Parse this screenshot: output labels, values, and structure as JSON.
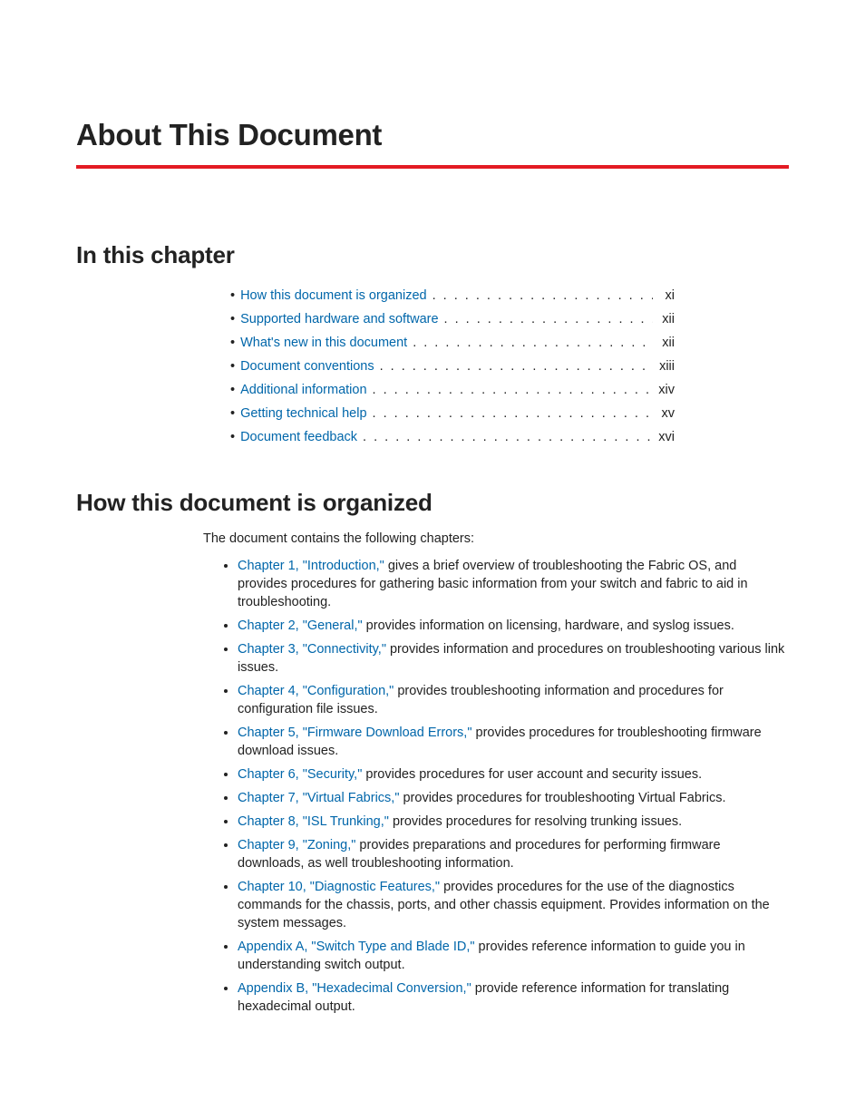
{
  "title": "About This Document",
  "sections": {
    "in_this_chapter": "In this chapter",
    "how_organized": "How this document is organized"
  },
  "toc": [
    {
      "label": "How this document is organized",
      "page": "xi"
    },
    {
      "label": "Supported hardware and software",
      "page": "xii"
    },
    {
      "label": "What's new in this document",
      "page": "xii"
    },
    {
      "label": "Document conventions",
      "page": "xiii"
    },
    {
      "label": "Additional information",
      "page": "xiv"
    },
    {
      "label": "Getting technical help",
      "page": "xv"
    },
    {
      "label": "Document feedback",
      "page": "xvi"
    }
  ],
  "intro_text": "The document contains the following chapters:",
  "chapters": [
    {
      "link": "Chapter 1, \"Introduction,\"",
      "desc": " gives a brief overview of troubleshooting the Fabric OS, and provides procedures for gathering basic information from your switch and fabric to aid in troubleshooting."
    },
    {
      "link": "Chapter 2, \"General,\"",
      "desc": " provides information on licensing, hardware, and syslog issues."
    },
    {
      "link": "Chapter 3, \"Connectivity,\"",
      "desc": " provides information and procedures on troubleshooting various link issues."
    },
    {
      "link": "Chapter 4, \"Configuration,\"",
      "desc": " provides troubleshooting information and procedures for configuration file issues."
    },
    {
      "link": "Chapter 5, \"Firmware Download Errors,\"",
      "desc": " provides procedures for troubleshooting firmware download issues."
    },
    {
      "link": "Chapter 6, \"Security,\"",
      "desc": " provides procedures for user account and security issues."
    },
    {
      "link": "Chapter 7, \"Virtual Fabrics,\"",
      "desc": " provides procedures for troubleshooting Virtual Fabrics."
    },
    {
      "link": "Chapter 8, \"ISL Trunking,\"",
      "desc": " provides procedures for resolving trunking issues."
    },
    {
      "link": "Chapter 9, \"Zoning,\"",
      "desc": " provides preparations and procedures for performing firmware downloads, as well troubleshooting information."
    },
    {
      "link": "Chapter 10, \"Diagnostic Features,\"",
      "desc": " provides procedures for the use of the diagnostics commands for the chassis, ports, and other chassis equipment. Provides information on the system messages."
    },
    {
      "link": "Appendix A, \"Switch Type and Blade ID,\"",
      "desc": " provides reference information to guide you in understanding switch output."
    },
    {
      "link": "Appendix B, \"Hexadecimal Conversion,\"",
      "desc": " provide reference information for translating hexadecimal output."
    }
  ],
  "dots": " . . . . . . . . . . . . . . . . . . . . . . . . . . . . . . . . . . . . . . . . . . . . . . . . . . . . . . . . . . . ."
}
